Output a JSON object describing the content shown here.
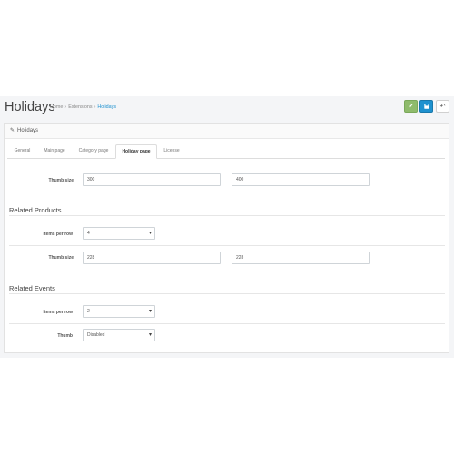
{
  "header": {
    "title": "Holidays",
    "breadcrumb": [
      {
        "label": "Home"
      },
      {
        "label": "Extensions"
      },
      {
        "label": "Holidays",
        "active": true
      }
    ],
    "buttons": {
      "save_icon": "check-icon",
      "disk_icon": "floppy-disk-icon",
      "back_icon": "reply-icon"
    }
  },
  "panel": {
    "heading": "Holidays",
    "heading_icon": "pencil-icon",
    "tabs": [
      "General",
      "Main page",
      "Category page",
      "Holiday page",
      "License"
    ],
    "active_tab": "Holiday page"
  },
  "form": {
    "holiday_thumb": {
      "label": "Thumb size",
      "width": "300",
      "height": "400"
    },
    "related_products": {
      "title": "Related Products",
      "items_per_row_label": "Items per row",
      "items_per_row_value": "4",
      "thumb_label": "Thumb size",
      "thumb_width": "228",
      "thumb_height": "228"
    },
    "related_events": {
      "title": "Related Events",
      "items_per_row_label": "Items per row",
      "items_per_row_value": "2",
      "thumb_label": "Thumb",
      "thumb_value": "Disabled"
    }
  },
  "colors": {
    "accent_blue": "#1e91cf",
    "save_green": "#8fbb6c",
    "background": "#f4f5f7"
  }
}
